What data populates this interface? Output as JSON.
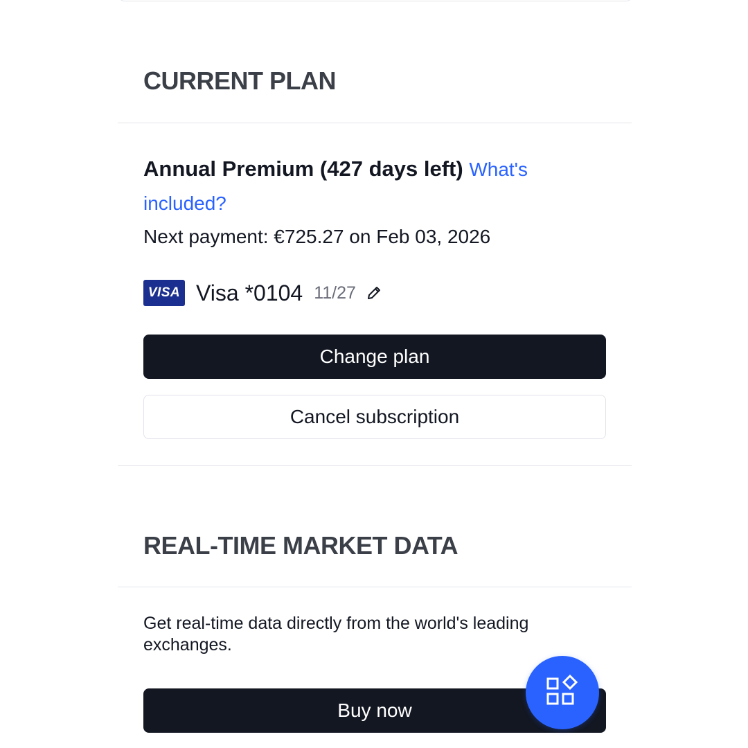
{
  "current_plan": {
    "section_title": "CURRENT PLAN",
    "plan_name": "Annual Premium (427 days left)",
    "whats_included_link": "What's included?",
    "next_payment": "Next payment: €725.27 on Feb 03, 2026",
    "payment_card": {
      "brand_badge": "VISA",
      "name": "Visa *0104",
      "expiry": "11/27",
      "edit_icon": "pencil-icon"
    },
    "change_plan_button": "Change plan",
    "cancel_subscription_button": "Cancel subscription"
  },
  "market_data": {
    "section_title": "REAL-TIME MARKET DATA",
    "description": "Get real-time data directly from the world's leading exchanges.",
    "buy_now_button": "Buy now"
  },
  "fab": {
    "icon": "apps-grid-icon"
  },
  "colors": {
    "primary_dark": "#131722",
    "link_blue": "#2962ff",
    "fab_blue": "#2962ff",
    "visa_blue": "#1a2f8f",
    "section_title_gray": "#3b3f47",
    "divider": "#e3e5ea",
    "muted_text": "#6a6d78"
  }
}
